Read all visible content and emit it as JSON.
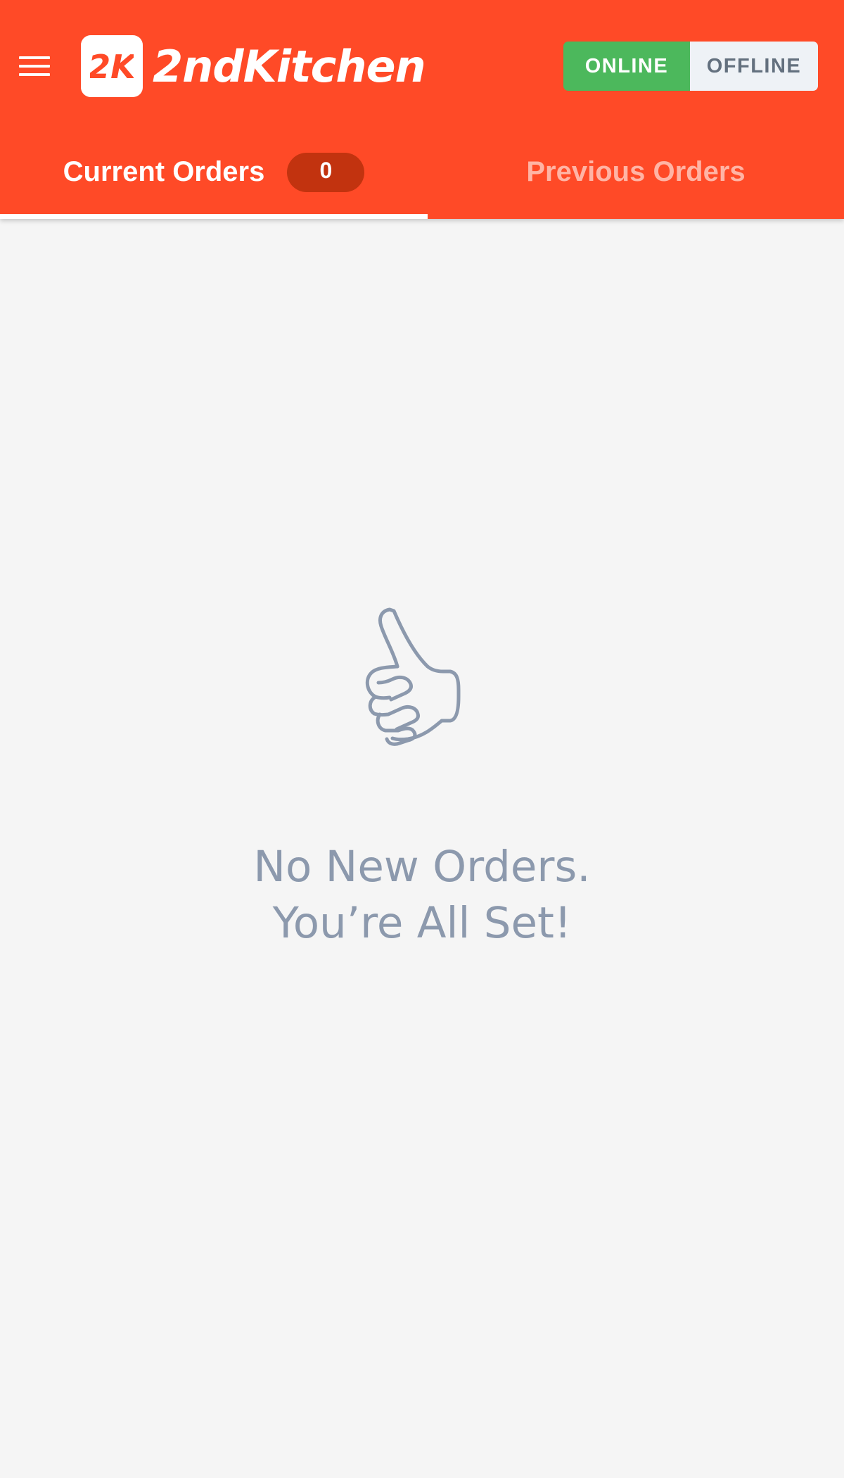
{
  "header": {
    "brand_name": "2ndKitchen",
    "brand_mark": "2K",
    "menu_icon": "hamburger-menu-icon",
    "status_toggle": {
      "options": [
        "ONLINE",
        "OFFLINE"
      ],
      "selected": "ONLINE"
    }
  },
  "tabs": [
    {
      "label": "Current Orders",
      "badge": "0",
      "active": true
    },
    {
      "label": "Previous Orders",
      "active": false
    }
  ],
  "empty_state": {
    "icon": "thumbs-up-icon",
    "line1": "No New Orders.",
    "line2": "You’re All Set!"
  },
  "colors": {
    "brand": "#ff4a27",
    "online": "#4cb85c",
    "offline_bg": "#eef2f6",
    "badge": "#c2330f",
    "inactive_tab": "#ffb4a5",
    "empty_text": "#8c99ad",
    "background": "#f5f5f5"
  }
}
